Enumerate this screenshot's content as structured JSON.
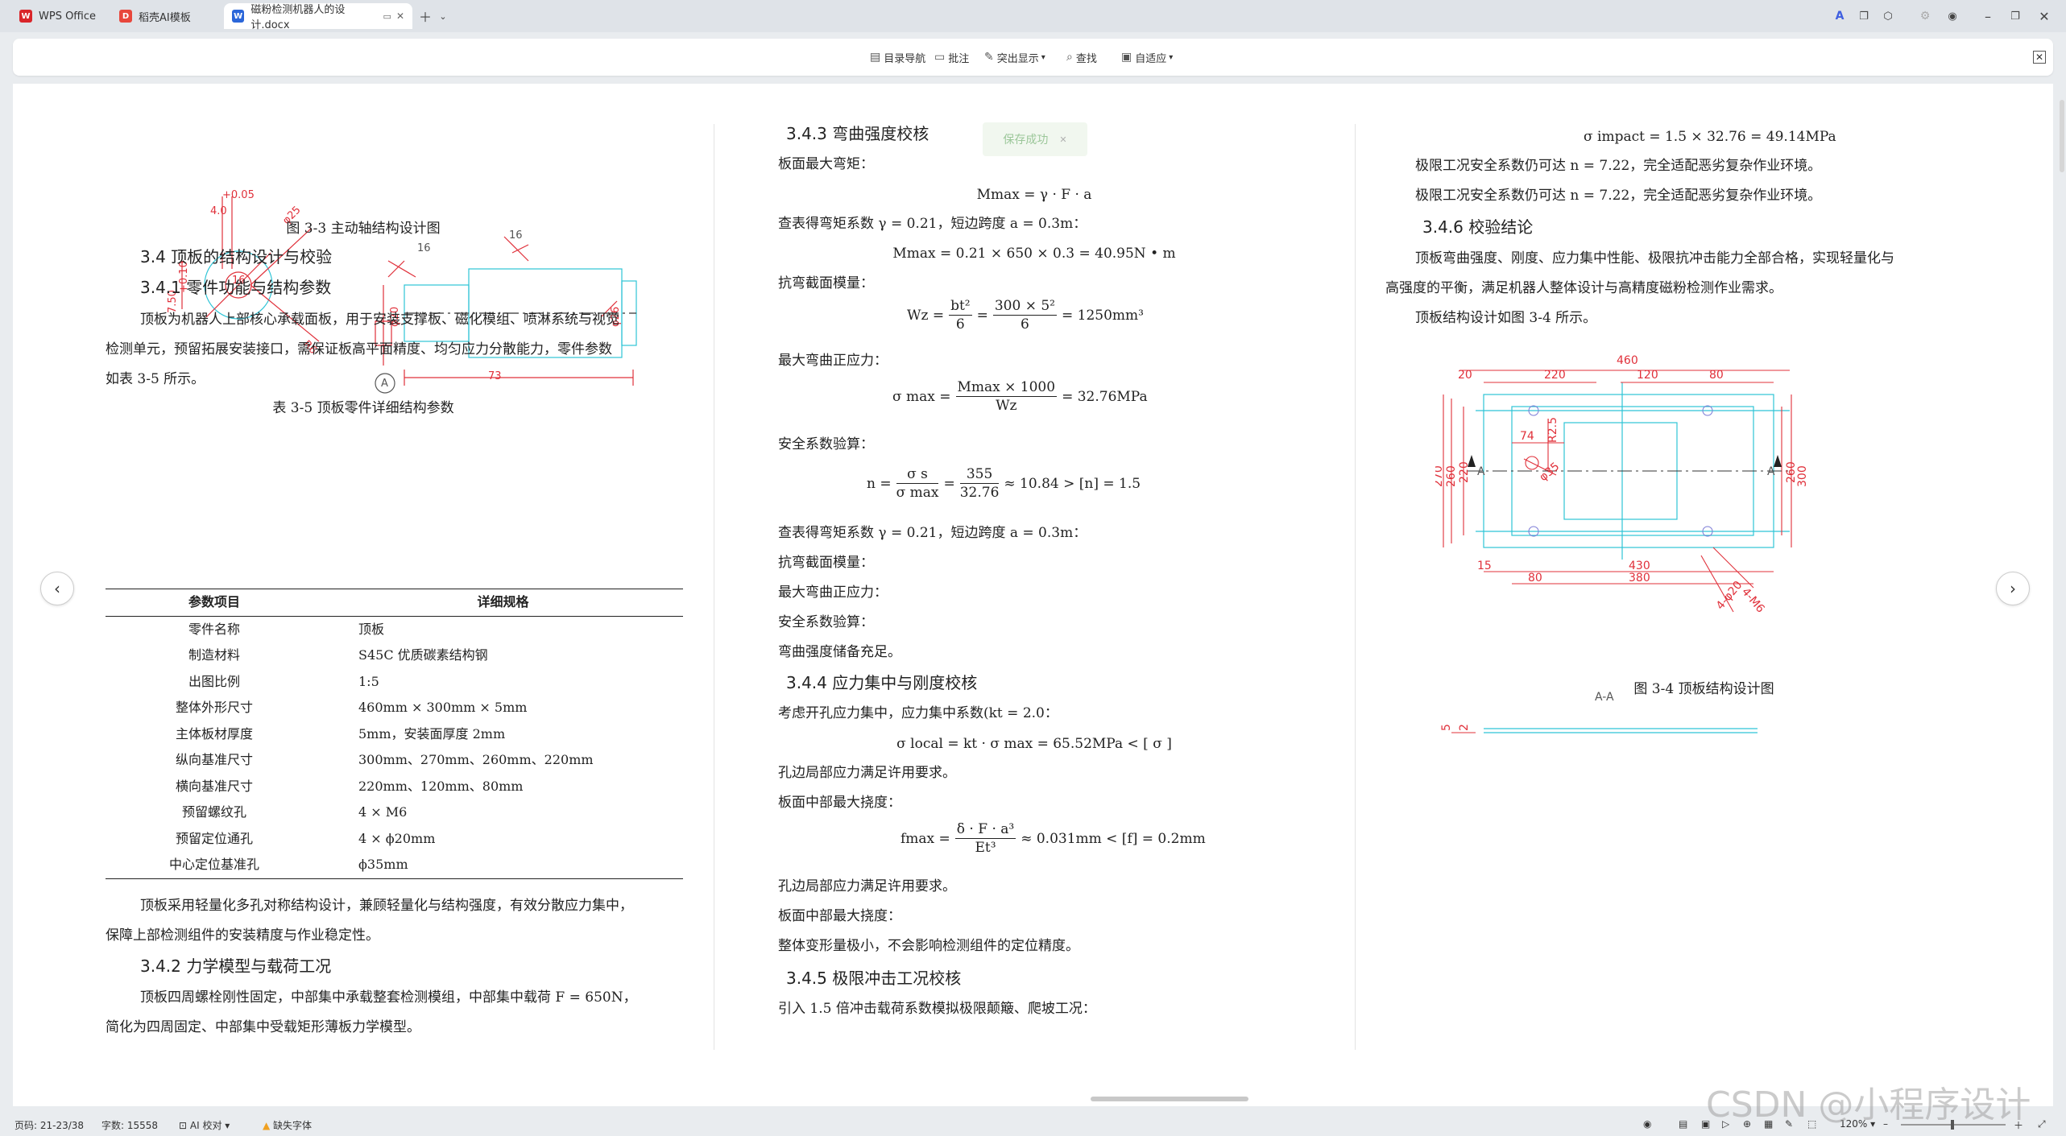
{
  "tabs": [
    {
      "label": "WPS Office",
      "icon": "wps-logo-icon",
      "color": "#d9252a"
    },
    {
      "label": "稻壳AI模板",
      "icon": "docer-logo-icon",
      "color": "#e8473c"
    },
    {
      "label": "磁粉检测机器人的设计.docx",
      "icon": "word-doc-icon",
      "color": "#2b66d9"
    }
  ],
  "toolbar": {
    "outline": "目录导航",
    "comment": "批注",
    "highlight": "突出显示",
    "find": "查找",
    "fit": "自适应"
  },
  "toast": "保存成功",
  "col1": {
    "drawing1": {
      "dims": [
        "+0.05",
        "4.0",
        "7.50",
        "+0.10",
        "φ25",
        "16",
        "16",
        "φ20",
        "73",
        "A"
      ]
    },
    "fig33_caption": "图  3-3  主动轴结构设计图",
    "h34": "3.4  顶板的结构设计与校验",
    "h341": "3.4.1  零件功能与结构参数",
    "para1_l1": "顶板为机器人上部核心承载面板，用于安装支撑板、磁化模组、喷淋系统与视觉",
    "para1_l2": "检测单元，预留拓展安装接口，需保证板高平面精度、均匀应力分散能力，零件参数",
    "para1_l3": "如表  3-5  所示。",
    "table_caption": "表  3-5  顶板零件详细结构参数",
    "table_headers": [
      "参数项目",
      "详细规格"
    ],
    "table_rows": [
      [
        "零件名称",
        "顶板"
      ],
      [
        "制造材料",
        "S45C  优质碳素结构钢"
      ],
      [
        "出图比例",
        "1:5"
      ],
      [
        "整体外形尺寸",
        "460mm × 300mm × 5mm"
      ],
      [
        "主体板材厚度",
        "5mm，安装面厚度 2mm"
      ],
      [
        "纵向基准尺寸",
        "300mm、270mm、260mm、220mm"
      ],
      [
        "横向基准尺寸",
        "220mm、120mm、80mm"
      ],
      [
        "预留螺纹孔",
        "4 × M6"
      ],
      [
        "预留定位通孔",
        "4 × ϕ20mm"
      ],
      [
        "中心定位基准孔",
        "ϕ35mm"
      ]
    ],
    "para2_l1": "顶板采用轻量化多孔对称结构设计，兼顾轻量化与结构强度，有效分散应力集中，",
    "para2_l2": "保障上部检测组件的安装精度与作业稳定性。",
    "h342": "3.4.2  力学模型与载荷工况",
    "para3_l1": "顶板四周螺栓刚性固定，中部集中承载整套检测模组，中部集中载荷 F = 650N，",
    "para3_l2": "简化为四周固定、中部集中受载矩形薄板力学模型。"
  },
  "col2": {
    "h343": "3.4.3  弯曲强度校核",
    "l1": "板面最大弯矩：",
    "eq_m": "Mmax = γ · F · a",
    "l2": "查表得弯矩系数 γ = 0.21，短边跨度 a = 0.3m：",
    "eq_m2": "Mmax = 0.21 × 650 × 0.3 = 40.95N • m",
    "l3": "抗弯截面模量：",
    "eq_w_lhs": "Wz =",
    "eq_w_f1n": "bt²",
    "eq_w_f1d": "6",
    "eq_w_f2n": "300 × 5²",
    "eq_w_f2d": "6",
    "eq_w_rhs": "= 1250mm³",
    "l4": "最大弯曲正应力：",
    "eq_s_lhs": "σ max =",
    "eq_s_n": "Mmax × 1000",
    "eq_s_d": "Wz",
    "eq_s_rhs": "= 32.76MPa",
    "l5": "安全系数验算：",
    "eq_n_lhs": "n =",
    "eq_n_f1n": "σ s",
    "eq_n_f1d": "σ max",
    "eq_n_f2n": "355",
    "eq_n_f2d": "32.76",
    "eq_n_rhs": "≈ 10.84 > [n] = 1.5",
    "l6": "查表得弯矩系数 γ = 0.21，短边跨度 a = 0.3m：",
    "l7": "抗弯截面模量：",
    "l8": "最大弯曲正应力：",
    "l9": "安全系数验算：",
    "l10": "弯曲强度储备充足。",
    "h344": "3.4.4  应力集中与刚度校核",
    "l11": "考虑开孔应力集中，应力集中系数(kt = 2.0：",
    "eq_local": "σ local = kt · σ max = 65.52MPa < [ σ ]",
    "l12": "孔边局部应力满足许用要求。",
    "l13": "板面中部最大挠度：",
    "eq_f_lhs": "fmax =",
    "eq_f_n": "δ · F · a³",
    "eq_f_d": "Et³",
    "eq_f_rhs": "≈ 0.031mm < [f] = 0.2mm",
    "l14": "孔边局部应力满足许用要求。",
    "l15": "板面中部最大挠度：",
    "l16": "整体变形量极小，不会影响检测组件的定位精度。",
    "h345": "3.4.5  极限冲击工况校核",
    "l17": "引入  1.5  倍冲击载荷系数模拟极限颠簸、爬坡工况："
  },
  "col3": {
    "eq_impact": "σ impact = 1.5 × 32.76 = 49.14MPa",
    "l1": "极限工况安全系数仍可达 n = 7.22，完全适配恶劣复杂作业环境。",
    "l2": "极限工况安全系数仍可达 n = 7.22，完全适配恶劣复杂作业环境。",
    "h346": "3.4.6  校验结论",
    "p1_l1": "顶板弯曲强度、刚度、应力集中性能、极限抗冲击能力全部合格，实现轻量化与",
    "p1_l2": "高强度的平衡，满足机器人整体设计与高精度磁粉检测作业需求。",
    "p2": "顶板结构设计如图  3-4  所示。",
    "drawing2": {
      "dims": [
        "460",
        "20",
        "220",
        "120",
        "80",
        "74",
        "R2.5",
        "φ35",
        "270",
        "260",
        "220",
        "300",
        "260",
        "A",
        "A",
        "15",
        "430",
        "80",
        "380",
        "4-M6",
        "4-φ20",
        "A-A",
        "5",
        "2"
      ]
    },
    "fig34_caption": "图  3-4  顶板结构设计图"
  },
  "statusbar": {
    "pages": "页码: 21-23/38",
    "words": "字数: 15558",
    "ai_check": "AI 校对",
    "missing_font": "缺失字体",
    "zoom": "120%"
  },
  "watermark": "CSDN @小程序设计",
  "colors": {
    "accent": "#2b66d9",
    "cad_red": "#e0303a",
    "cad_cyan": "#2ec4d6"
  }
}
